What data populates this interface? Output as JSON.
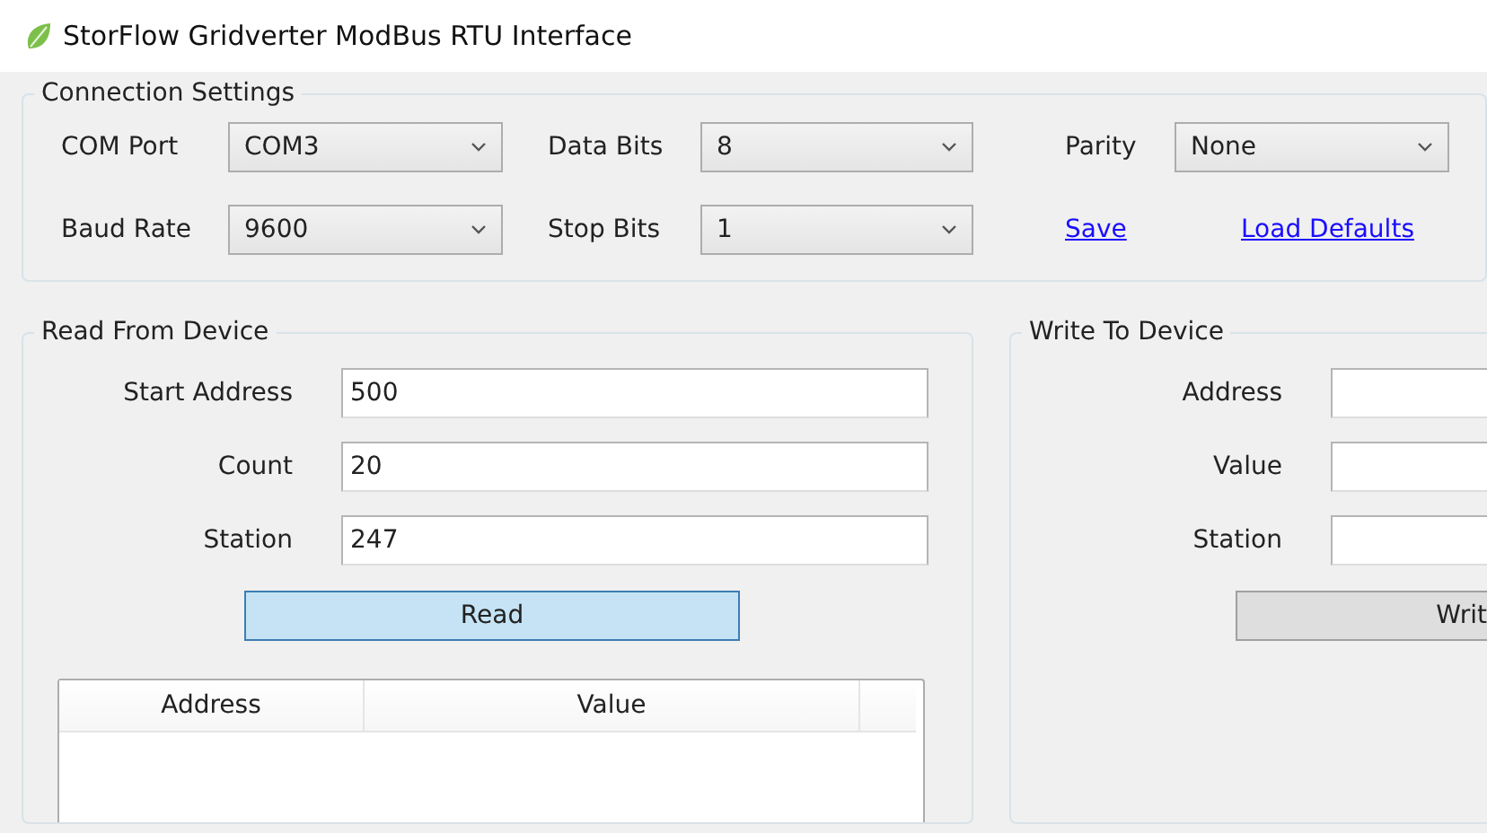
{
  "window": {
    "title": "StorFlow Gridverter ModBus RTU Interface"
  },
  "connection_settings": {
    "title": "Connection Settings",
    "combos": [
      {
        "label": "COM Port",
        "value": "COM3"
      },
      {
        "label": "Data Bits",
        "value": "8"
      },
      {
        "label": "Parity",
        "value": "None"
      },
      {
        "label": "Baud Rate",
        "value": "9600"
      },
      {
        "label": "Stop Bits",
        "value": "1"
      }
    ],
    "links": [
      "Save",
      "Load Defaults"
    ]
  },
  "read_from_device": {
    "title": "Read From Device",
    "fields": [
      {
        "label": "Start Address",
        "value": "500"
      },
      {
        "label": "Count",
        "value": "20"
      },
      {
        "label": "Station",
        "value": "247"
      }
    ],
    "button": "Read",
    "table": {
      "columns": [
        "Address",
        "Value"
      ]
    }
  },
  "write_to_device": {
    "title": "Write To Device",
    "fields": [
      {
        "label": "Address"
      },
      {
        "label": "Value"
      },
      {
        "label": "Station"
      }
    ],
    "button": "Writ"
  }
}
